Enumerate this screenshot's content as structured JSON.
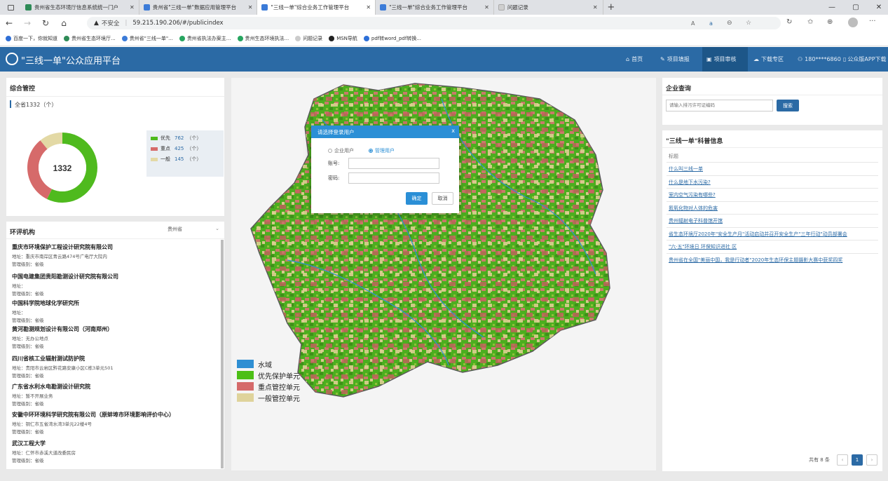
{
  "browser": {
    "tabs": [
      {
        "title": "贵州省生态环境厅信息系统统一门户",
        "color": "#2e8b57"
      },
      {
        "title": "贵州省\"三线一单\"数据应用管理平台",
        "color": "#3b7bd8"
      },
      {
        "title": "\"三线一单\"综合业务工作管理平台",
        "color": "#3b7bd8"
      },
      {
        "title": "\"三线一单\"综合业务工作管理平台",
        "color": "#3b7bd8"
      },
      {
        "title": "问题记录",
        "color": "#cfcfcf"
      }
    ],
    "insecure_label": "不安全",
    "url": "59.215.190.206/#/publicindex",
    "bookmarks": [
      {
        "label": "百度一下，你就知道",
        "color": "#2f6fd6"
      },
      {
        "label": "贵州省生态环境厅...",
        "color": "#2e8b57"
      },
      {
        "label": "贵州省\"三线一单\"...",
        "color": "#3b7bd8"
      },
      {
        "label": "贵州省执法办案主...",
        "color": "#27a560"
      },
      {
        "label": "贵州生态环境执法...",
        "color": "#27a560"
      },
      {
        "label": "问题记录",
        "color": "#cccccc"
      },
      {
        "label": "MSN导航",
        "color": "#222222"
      },
      {
        "label": "pdf转word_pdf转换...",
        "color": "#2d6fd8"
      }
    ]
  },
  "header": {
    "title": "\"三线一单\"公众应用平台",
    "nav": [
      "首页",
      "项目填报",
      "项目审核",
      "下载专区",
      "180****6860",
      "公众版APP下载"
    ]
  },
  "summary": {
    "title": "综合管控",
    "total_label": "全省1332（个）",
    "total": "1332",
    "legend": [
      {
        "label": "优先",
        "value": "762",
        "unit": "（个）",
        "color": "#4fba1e"
      },
      {
        "label": "重点",
        "value": "425",
        "unit": "（个）",
        "color": "#d66a6a"
      },
      {
        "label": "一般",
        "value": "145",
        "unit": "（个）",
        "color": "#e3d9a5"
      }
    ],
    "donut": [
      762,
      425,
      145
    ]
  },
  "agencies": {
    "title": "环评机构",
    "filter": "贵州省",
    "items": [
      {
        "name": "重庆市环境保护工程设计研究院有限公司",
        "address": "地址：重庆市南岸区青云路474号广电厅大院内",
        "level": "管理级别：省级"
      },
      {
        "name": "中国电建集团贵阳勘测设计研究院有限公司",
        "address": "地址：",
        "level": "管理级别：省级"
      },
      {
        "name": "中国科学院地球化学研究所",
        "address": "地址：",
        "level": "管理级别：省级"
      },
      {
        "name": "黄河勘测规划设计有限公司（河南郑州）",
        "address": "地址：无办公地点",
        "level": "管理级别：省级"
      },
      {
        "name": "四川省核工业辐射测试防护院",
        "address": "地址：贵阳市云岩区黔花路安康小区C栋3单元501",
        "level": "管理级别：省级"
      },
      {
        "name": "广东省水利水电勘测设计研究院",
        "address": "地址：暂不开展业务",
        "level": "管理级别：省级"
      },
      {
        "name": "安徽中环环境科学研究院有限公司（原蚌埠市环境影响评价中心）",
        "address": "地址：铜仁市五省湾水湾3单元22楼4号",
        "level": "管理级别：省级"
      },
      {
        "name": "武汉工程大学",
        "address": "地址：仁怀市赤溪大道改委民房",
        "level": "管理级别：省级"
      }
    ]
  },
  "map": {
    "legend": [
      {
        "label": "水域",
        "color": "#2f8fd3"
      },
      {
        "label": "优先保护单元",
        "color": "#4cbf16"
      },
      {
        "label": "重点管控单元",
        "color": "#d56a6a"
      },
      {
        "label": "一般管控单元",
        "color": "#dfd39b"
      }
    ]
  },
  "enterprise": {
    "title": "企业查询",
    "placeholder": "请输入排污许可证编码",
    "search_label": "搜索"
  },
  "science": {
    "title": "\"三线一单\"科普信息",
    "column": "标题",
    "items": [
      "什么叫三线一单",
      "什么是地下水污染?",
      "室内空气污染有哪些?",
      "氮氧化物对人体的危害",
      "贵州辐射电子科普馆开馆",
      "省生态环境厅2020年\"安全生产月\"活动启动并召开安全生产\"三年行动\"动员部署会",
      "\"六·五\"环境日 环保知识进社 区",
      "贵州省在全国\"美丽中国，我是行动者\"2020年生态环保主题摄影大赛中获奖四奖"
    ],
    "total_label": "共有 8 条",
    "page": "1"
  },
  "modal": {
    "title": "请选择登录用户",
    "close": "x",
    "options": [
      "企业用户",
      "管理用户"
    ],
    "account_label": "账号:",
    "password_label": "密码:",
    "confirm": "确定",
    "cancel": "取消"
  }
}
